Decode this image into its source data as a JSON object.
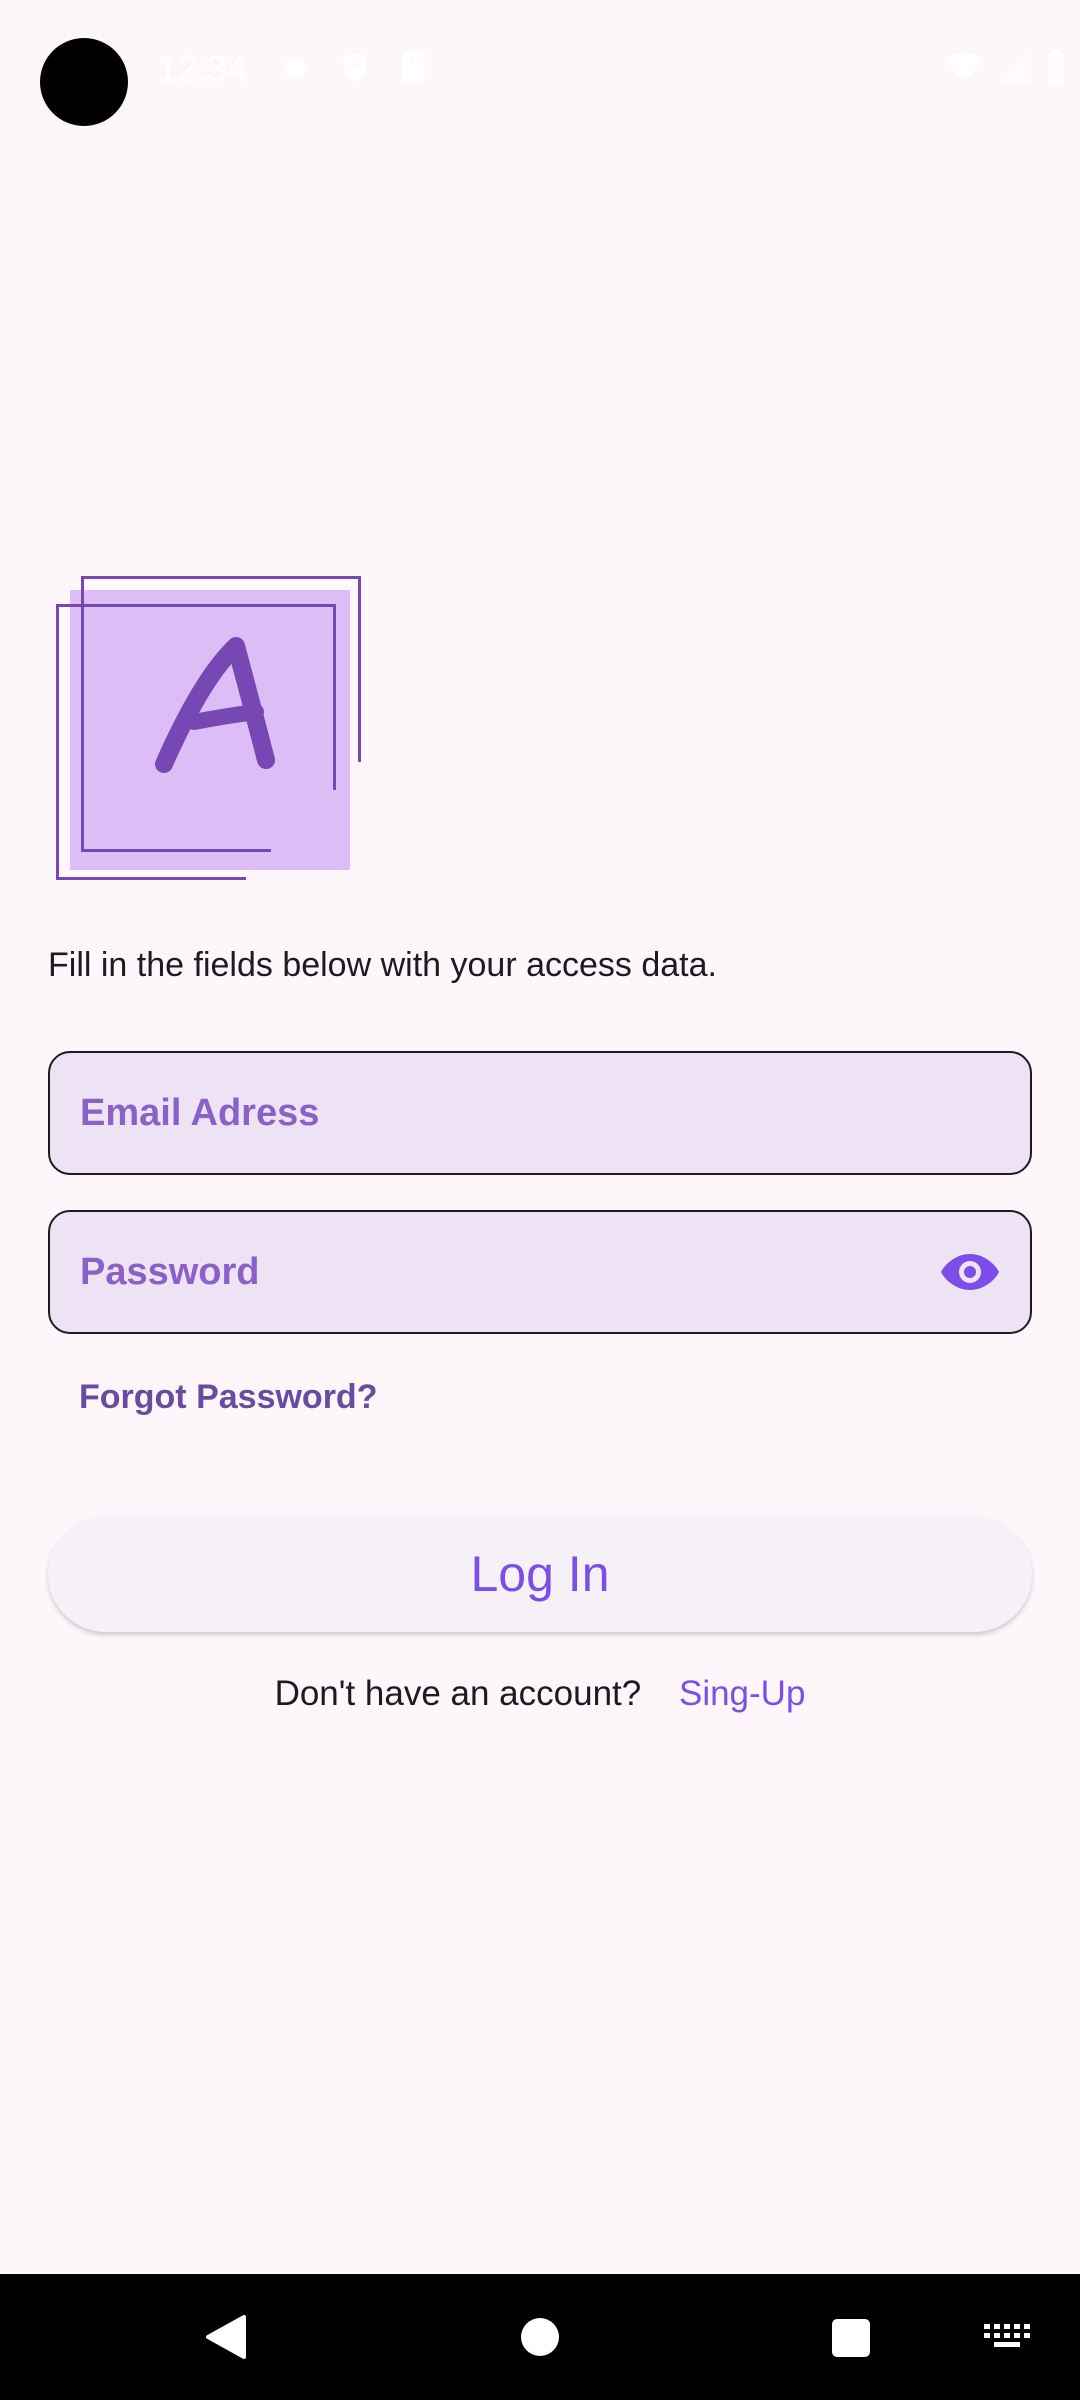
{
  "status_bar": {
    "time": "12:34",
    "left_icons": [
      "gear-icon",
      "location-icon",
      "sd-card-icon"
    ],
    "right_icons": [
      "wifi-icon",
      "signal-icon",
      "battery-icon"
    ]
  },
  "logo": {
    "letter": "A"
  },
  "intro": {
    "text": "Fill in the fields below with your access data."
  },
  "email_field": {
    "placeholder": "Email Adress",
    "value": ""
  },
  "password_field": {
    "placeholder": "Password",
    "value": "",
    "toggle_icon": "eye-icon"
  },
  "forgot_link": {
    "label": "Forgot Password?"
  },
  "login_button": {
    "label": "Log In"
  },
  "signup": {
    "question": "Don't have an account?",
    "link": "Sing-Up"
  },
  "nav_bar": {
    "icons": [
      "back-icon",
      "home-icon",
      "recents-icon",
      "keyboard-icon"
    ]
  },
  "colors": {
    "background": "#fdf7fc",
    "field_fill": "#ede3f5",
    "field_placeholder": "#8b60c7",
    "accent": "#7b4ee8",
    "logo_fill": "#dcbdf6",
    "logo_stroke": "#7747b4",
    "forgot_link": "#6a4ba0"
  }
}
